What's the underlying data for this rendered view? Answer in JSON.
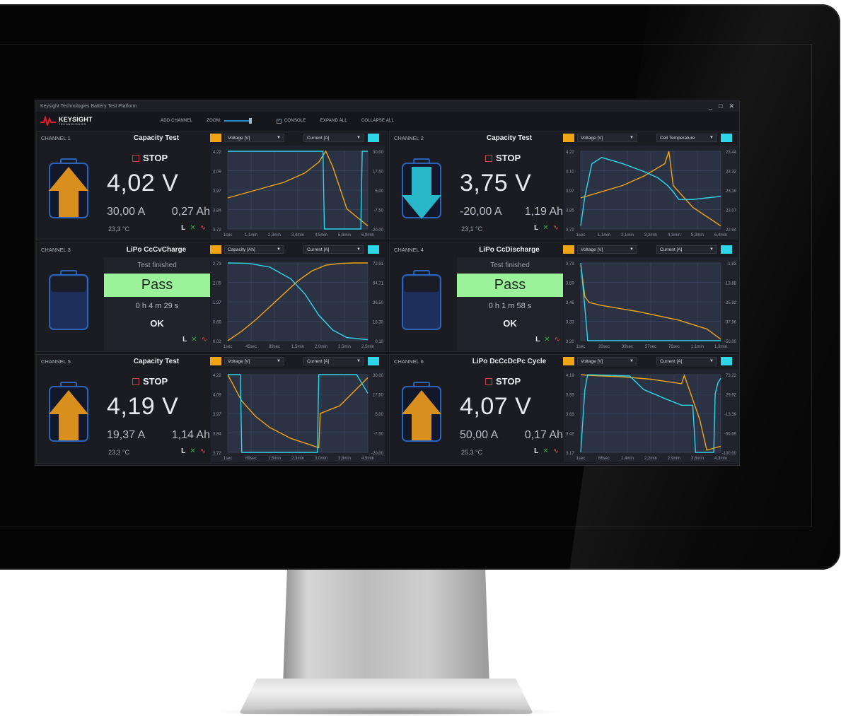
{
  "window": {
    "title": "Keysight Technologies Battery Test Platform",
    "minimize": "_",
    "maximize": "□",
    "close": "✕"
  },
  "toolbar": {
    "brand": "KEYSIGHT",
    "brand_sub": "TECHNOLOGIES",
    "add_channel": "ADD CHANNEL",
    "zoom": "ZOOM:",
    "console": "CONSOLE",
    "console_checked": "✓",
    "expand_all": "EXPAND ALL",
    "collapse_all": "COLLAPSE ALL"
  },
  "colors": {
    "accent_orange": "#f0a515",
    "accent_cyan": "#2fd6e8",
    "pass_green": "#9cf29a",
    "battery_orange": "#d88f1e",
    "battery_cyan": "#27b7c8"
  },
  "channels": [
    {
      "name": "CHANNEL 1",
      "test": "Capacity Test",
      "state": "running",
      "direction": "charge",
      "stop": "STOP",
      "voltage": "4,02 V",
      "current": "30,00 A",
      "capacity": "0,27 Ah",
      "temperature": "23,3 °C",
      "left_select": "Voltage [V]",
      "right_select": "Current [A]",
      "icons": {
        "l": "L",
        "x": "✕",
        "wave": "∿"
      },
      "left_ticks": [
        "4,22",
        "4,09",
        "3,97",
        "3,84",
        "3,72"
      ],
      "right_ticks": [
        "30,00",
        "17,50",
        "5,00",
        "-7,50",
        "-20,00"
      ],
      "x_ticks": [
        "1sec",
        "1,1min",
        "2,3min",
        "3,4min",
        "4,5min",
        "5,6min",
        "6,8min"
      ],
      "chart_data": {
        "type": "line",
        "series": [
          {
            "color": "#f0a515",
            "axis": "left",
            "x": [
              0,
              0.2,
              0.4,
              0.55,
              0.65,
              0.7,
              0.75,
              0.85,
              1.0
            ],
            "y": [
              3.92,
              3.97,
              4.02,
              4.08,
              4.15,
              4.22,
              4.12,
              3.85,
              3.74
            ]
          },
          {
            "color": "#2fd6e8",
            "axis": "right",
            "x": [
              0,
              0.68,
              0.69,
              0.85,
              0.95,
              0.96,
              1.0
            ],
            "y": [
              30,
              30,
              -20,
              -20,
              -20,
              30,
              30
            ]
          }
        ]
      }
    },
    {
      "name": "CHANNEL 2",
      "test": "Capacity Test",
      "state": "running",
      "direction": "discharge",
      "stop": "STOP",
      "voltage": "3,75 V",
      "current": "-20,00 A",
      "capacity": "1,19 Ah",
      "temperature": "23,1 °C",
      "left_select": "Voltage [V]",
      "right_select": "Cell Temperature",
      "icons": {
        "l": "L",
        "x": "✕",
        "wave": "∿"
      },
      "left_ticks": [
        "4,22",
        "4,10",
        "3,97",
        "3,85",
        "3,72"
      ],
      "right_ticks": [
        "23,44",
        "23,32",
        "23,19",
        "23,07",
        "22,94"
      ],
      "x_ticks": [
        "1sec",
        "1,1min",
        "2,1min",
        "3,2min",
        "4,3min",
        "5,3min",
        "6,4min"
      ],
      "chart_data": {
        "type": "line",
        "series": [
          {
            "color": "#f0a515",
            "axis": "left",
            "x": [
              0,
              0.15,
              0.3,
              0.45,
              0.6,
              0.63,
              0.66,
              0.8,
              1.0
            ],
            "y": [
              3.92,
              3.96,
              4.0,
              4.06,
              4.14,
              4.22,
              4.0,
              3.86,
              3.74
            ]
          },
          {
            "color": "#2fd6e8",
            "axis": "right",
            "x": [
              0,
              0.03,
              0.08,
              0.15,
              0.3,
              0.45,
              0.55,
              0.62,
              0.66,
              0.7,
              0.8,
              0.9,
              1.0
            ],
            "y": [
              22.96,
              23.15,
              23.36,
              23.4,
              23.36,
              23.31,
              23.27,
              23.22,
              23.18,
              23.13,
              23.13,
              23.14,
              23.15
            ]
          }
        ]
      }
    },
    {
      "name": "CHANNEL 3",
      "test": "LiPo CcCvCharge",
      "state": "finished",
      "direction": "idle",
      "finished": "Test finished",
      "result": "Pass",
      "elapsed": "0 h 4 m 29 s",
      "ok": "OK",
      "left_select": "Capacity [Ah]",
      "right_select": "Current [A]",
      "icons": {
        "l": "L",
        "x": "✕",
        "wave": "∿"
      },
      "left_ticks": [
        "2,73",
        "2,05",
        "1,37",
        "0,69",
        "0,02"
      ],
      "right_ticks": [
        "72,91",
        "54,71",
        "36,50",
        "18,30",
        "0,10"
      ],
      "x_ticks": [
        "1sec",
        "45sec",
        "89sec",
        "1,5min",
        "2,0min",
        "2,5min",
        "2,5min"
      ],
      "chart_data": {
        "type": "line",
        "series": [
          {
            "color": "#f0a515",
            "axis": "left",
            "x": [
              0,
              0.1,
              0.2,
              0.3,
              0.4,
              0.5,
              0.6,
              0.7,
              0.8,
              0.9,
              1.0
            ],
            "y": [
              0.02,
              0.35,
              0.75,
              1.2,
              1.65,
              2.1,
              2.45,
              2.65,
              2.71,
              2.73,
              2.73
            ]
          },
          {
            "color": "#2fd6e8",
            "axis": "right",
            "x": [
              0,
              0.15,
              0.3,
              0.45,
              0.55,
              0.65,
              0.75,
              0.85,
              1.0
            ],
            "y": [
              72.9,
              72.5,
              69,
              58,
              44,
              24,
              10,
              3,
              1
            ]
          }
        ]
      }
    },
    {
      "name": "CHANNEL 4",
      "test": "LiPo CcDischarge",
      "state": "finished",
      "direction": "idle",
      "finished": "Test finished",
      "result": "Pass",
      "elapsed": "0 h 1 m 58 s",
      "ok": "OK",
      "left_select": "Voltage [V]",
      "right_select": "Current [A]",
      "icons": {
        "l": "L",
        "x": "✕",
        "wave": "∿"
      },
      "left_ticks": [
        "3,73",
        "3,59",
        "3,46",
        "3,33",
        "3,20"
      ],
      "right_ticks": [
        "-1,83",
        "-13,88",
        "-25,92",
        "-37,96",
        "-50,00"
      ],
      "x_ticks": [
        "1sec",
        "20sec",
        "39sec",
        "57sec",
        "76sec",
        "1,1min",
        "1,3min"
      ],
      "chart_data": {
        "type": "line",
        "series": [
          {
            "color": "#f0a515",
            "axis": "left",
            "x": [
              0,
              0.03,
              0.06,
              0.15,
              0.4,
              0.7,
              0.9,
              1.0
            ],
            "y": [
              3.72,
              3.5,
              3.46,
              3.44,
              3.4,
              3.34,
              3.28,
              3.21
            ]
          },
          {
            "color": "#2fd6e8",
            "axis": "right",
            "x": [
              0,
              0.02,
              0.05,
              0.06,
              1.0
            ],
            "y": [
              -1.83,
              -20,
              -50,
              -50,
              -50
            ]
          }
        ]
      }
    },
    {
      "name": "CHANNEL 5",
      "test": "Capacity Test",
      "state": "running",
      "direction": "charge",
      "stop": "STOP",
      "voltage": "4,19 V",
      "current": "19,37 A",
      "capacity": "1,14 Ah",
      "temperature": "23,3 °C",
      "left_select": "Voltage [V]",
      "right_select": "Current [A]",
      "icons": {
        "l": "L",
        "x": "✕",
        "wave": "∿"
      },
      "left_ticks": [
        "4,22",
        "4,09",
        "3,97",
        "3,84",
        "3,72"
      ],
      "right_ticks": [
        "30,00",
        "17,50",
        "5,00",
        "-7,50",
        "-20,00"
      ],
      "x_ticks": [
        "1sec",
        "69sec",
        "1,5min",
        "2,3min",
        "3,0min",
        "3,8min",
        "4,5min"
      ],
      "chart_data": {
        "type": "line",
        "series": [
          {
            "color": "#f0a515",
            "axis": "left",
            "x": [
              0,
              0.1,
              0.2,
              0.3,
              0.45,
              0.65,
              0.66,
              0.8,
              1.0
            ],
            "y": [
              4.22,
              4.05,
              3.95,
              3.88,
              3.81,
              3.75,
              3.97,
              4.02,
              4.2
            ]
          },
          {
            "color": "#2fd6e8",
            "axis": "right",
            "x": [
              0,
              0.09,
              0.1,
              0.64,
              0.65,
              0.92,
              0.96,
              1.0
            ],
            "y": [
              30,
              30,
              -20,
              -20,
              30,
              30,
              24,
              18
            ]
          }
        ]
      }
    },
    {
      "name": "CHANNEL 6",
      "test": "LiPo DcCcDcPc Cycle",
      "state": "running",
      "direction": "charge",
      "stop": "STOP",
      "voltage": "4,07 V",
      "current": "50,00 A",
      "capacity": "0,17 Ah",
      "temperature": "25,3 °C",
      "left_select": "Voltage [V]",
      "right_select": "Current [A]",
      "icons": {
        "l": "L",
        "x": "✕",
        "wave": "∿"
      },
      "left_ticks": [
        "4,19",
        "3,93",
        "3,68",
        "3,42",
        "3,17"
      ],
      "right_ticks": [
        "73,22",
        "29,92",
        "-13,39",
        "-56,69",
        "-100,00"
      ],
      "x_ticks": [
        "1sec",
        "66sec",
        "1,4min",
        "2,2min",
        "2,9min",
        "3,6min",
        "4,3min"
      ],
      "chart_data": {
        "type": "line",
        "series": [
          {
            "color": "#f0a515",
            "axis": "left",
            "x": [
              0,
              0.05,
              0.3,
              0.5,
              0.72,
              0.74,
              0.85,
              0.9,
              1.0
            ],
            "y": [
              4.19,
              4.18,
              4.16,
              4.13,
              4.07,
              4.18,
              3.6,
              3.2,
              3.25
            ]
          },
          {
            "color": "#2fd6e8",
            "axis": "right",
            "x": [
              0,
              0.03,
              0.05,
              0.35,
              0.45,
              0.6,
              0.72,
              0.8,
              0.82,
              0.95,
              0.96,
              0.98,
              1.0
            ],
            "y": [
              -100,
              40,
              73,
              70,
              40,
              20,
              5,
              5,
              -100,
              -100,
              30,
              55,
              65
            ]
          }
        ]
      }
    }
  ]
}
